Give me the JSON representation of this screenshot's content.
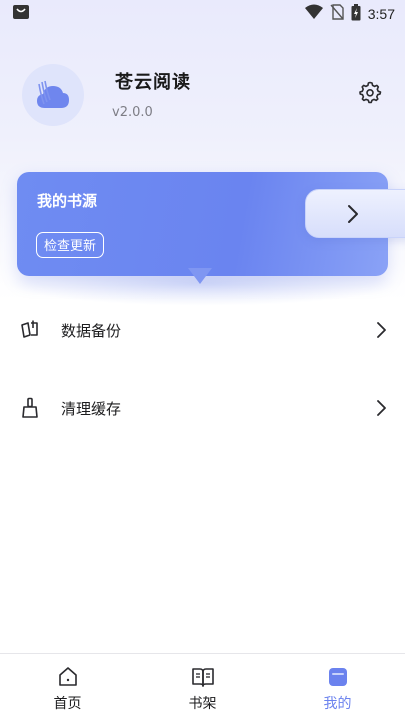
{
  "status_bar": {
    "time": "3:57",
    "icons": [
      "notification-bag-icon",
      "wifi-icon",
      "no-sim-icon",
      "battery-charging-icon"
    ]
  },
  "profile": {
    "app_name": "苍云阅读",
    "version": "v2.0.0",
    "avatar_icon": "cloud-book-logo",
    "settings_icon": "gear-icon"
  },
  "source_card": {
    "title": "我的书源",
    "check_update_label": "检查更新",
    "arrow_icon": "chevron-right-icon"
  },
  "menu": [
    {
      "label": "数据备份",
      "icon": "backup-icon"
    },
    {
      "label": "清理缓存",
      "icon": "broom-icon"
    }
  ],
  "bottom_nav": [
    {
      "label": "首页",
      "icon": "home-icon",
      "active": false
    },
    {
      "label": "书架",
      "icon": "book-icon",
      "active": false
    },
    {
      "label": "我的",
      "icon": "profile-card-icon",
      "active": true
    }
  ],
  "colors": {
    "accent": "#6b82ee",
    "card_start": "#6f8cf2",
    "card_end": "#8aa2f6",
    "background_top": "#e9eafc"
  }
}
